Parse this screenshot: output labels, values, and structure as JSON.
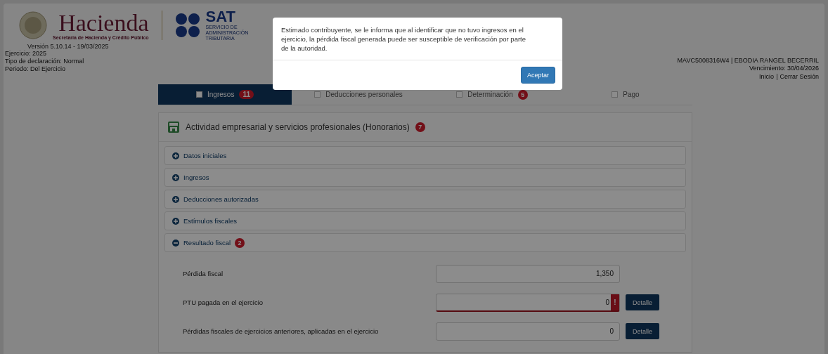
{
  "header": {
    "brand": "Hacienda",
    "brand_subtitle": "Secretaría de Hacienda y Crédito Público",
    "sat_name": "SAT",
    "sat_subtitle": "SERVICIO DE ADMINISTRACIÓN TRIBUTARIA",
    "version": "Versión 5.10.14 - 19/03/2025",
    "info": [
      "Ejercicio: 2025",
      "Tipo de declaración: Normal",
      "Periodo: Del Ejercicio"
    ],
    "user": "MAVC5008316W4 | EBODIA RANGEL BECERRIL",
    "due": "Vencimiento: 30/04/2026",
    "links": [
      {
        "label": "Inicio"
      },
      {
        "label": "Cerrar Sesión"
      }
    ],
    "link_separator": "|"
  },
  "tabs": [
    {
      "label": "Ingresos",
      "badge": "11",
      "selected": true
    },
    {
      "label": "Deducciones personales",
      "selected": false
    },
    {
      "label": "Determinación",
      "badge": "5",
      "selected": false
    },
    {
      "label": "Pago",
      "selected": false
    }
  ],
  "card": {
    "title": "Actividad empresarial y servicios profesionales (Honorarios)",
    "badge": "7"
  },
  "sections": [
    {
      "label": "Datos iniciales",
      "expanded": false
    },
    {
      "label": "Ingresos",
      "expanded": false
    },
    {
      "label": "Deducciones autorizadas",
      "expanded": false
    },
    {
      "label": "Estímulos fiscales",
      "expanded": false
    },
    {
      "label": "Resultado fiscal",
      "badge": "2",
      "expanded": true
    }
  ],
  "fields": [
    {
      "label": "Pérdida fiscal",
      "value": "1,350",
      "error": false
    },
    {
      "label": "PTU pagada en el ejercicio",
      "value": "0",
      "error": true,
      "detail": "Detalle"
    },
    {
      "label": "Pérdidas fiscales de ejercicios anteriores, aplicadas en el ejercicio",
      "value": "0",
      "error": false,
      "detail": "Detalle"
    }
  ],
  "error_mark": "!",
  "modal": {
    "message": "Estimado contribuyente, se le informa que al identificar que no tuvo ingresos en el ejercicio, la pérdida fiscal generada puede ser susceptible de verificación por parte de la autoridad.",
    "button": "Aceptar"
  }
}
